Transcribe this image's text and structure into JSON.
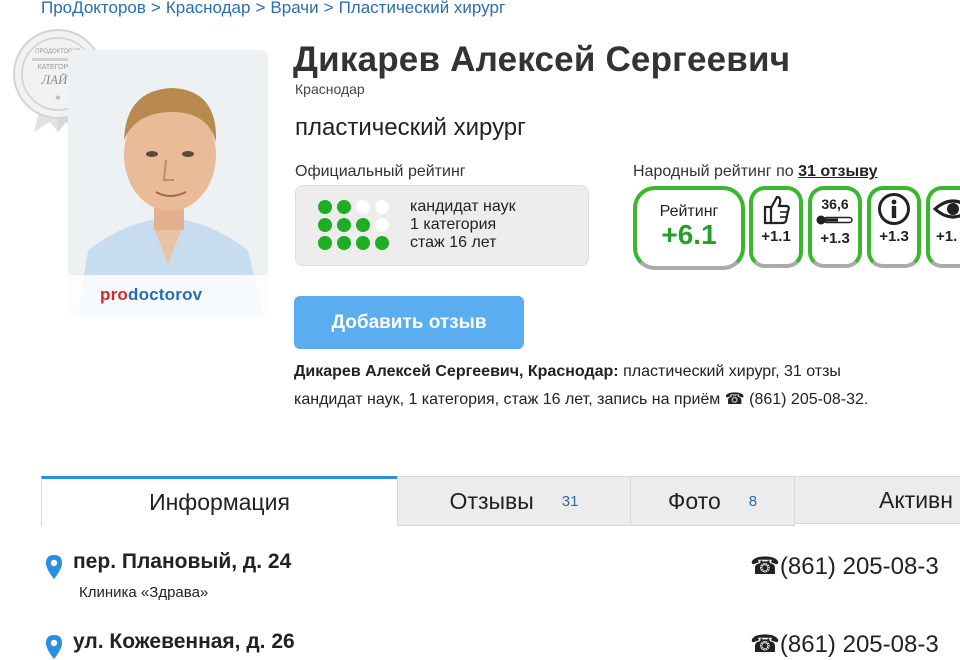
{
  "breadcrumb": [
    "ПроДокторов",
    "Краснодар",
    "Врачи",
    "Пластический хирург"
  ],
  "badge": {
    "line1": "ПРОДОКТОРОВ",
    "line2": "КАТЕГОРИЯ",
    "line3": "ЛАЙТ"
  },
  "photo": {
    "logo_pro": "pro",
    "logo_rest": "doctorov"
  },
  "doctor": {
    "name": "Дикарев Алексей Сергеевич",
    "city": "Краснодар",
    "specialty": "пластический хирург"
  },
  "official_rating": {
    "title": "Официальный рейтинг",
    "dots": [
      2,
      3,
      4
    ],
    "lines": [
      "кандидат наук",
      "1 категория",
      "стаж 16 лет"
    ]
  },
  "popular_rating": {
    "title_prefix": "Народный рейтинг по ",
    "title_count": "31 отзыву",
    "score_label": "Рейтинг",
    "score_value": "+6.1",
    "metrics": [
      {
        "icon": "thumbs-up-icon",
        "value": "+1.1"
      },
      {
        "icon": "thermometer-icon",
        "top": "36,6",
        "value": "+1.3"
      },
      {
        "icon": "info-icon",
        "value": "+1.3"
      },
      {
        "icon": "eye-icon",
        "value": "+1."
      }
    ]
  },
  "add_review_label": "Добавить отзыв",
  "summary": {
    "bold": "Дикарев Алексей Сергеевич, Краснодар:",
    "rest1": " пластический хирург, 31 отзы",
    "line2_text": "кандидат наук, 1 категория, стаж 16 лет, запись на приём ",
    "phone_icon": "☎",
    "phone": " (861) 205-08-32."
  },
  "tabs": [
    {
      "label": "Информация",
      "count": "",
      "active": true
    },
    {
      "label": "Отзывы",
      "count": "31",
      "active": false
    },
    {
      "label": "Фото",
      "count": "8",
      "active": false
    },
    {
      "label": "Активн",
      "count": "",
      "active": false
    }
  ],
  "address": {
    "street": "пер. Плановый, д. 24",
    "clinic": "Клиника «Здрава»",
    "phone": "☎(861) 205-08-3"
  },
  "address2": {
    "street": "ул. Кожевенная, д. 26",
    "phone": "☎(861) 205-08-3"
  }
}
